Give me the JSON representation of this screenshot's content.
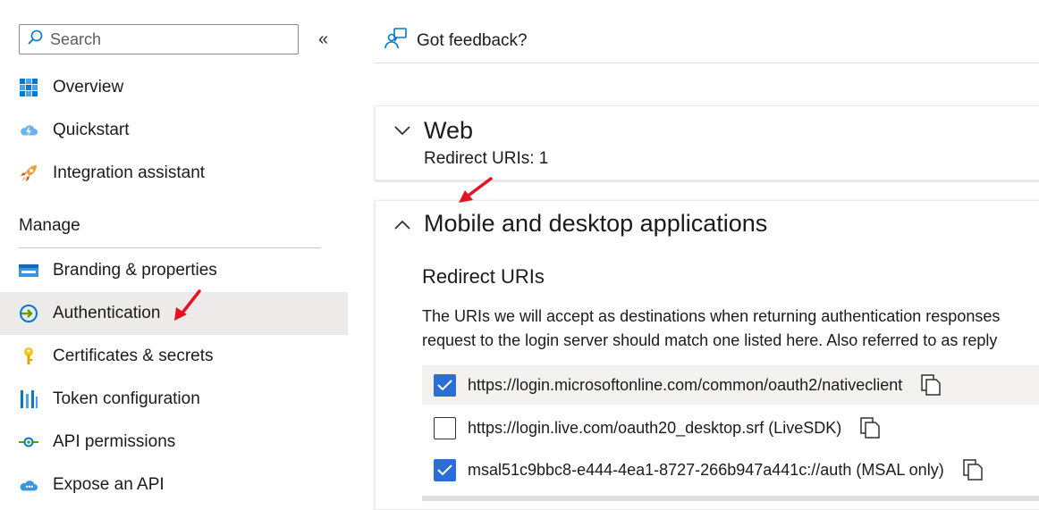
{
  "sidebar": {
    "search_placeholder": "Search",
    "collapse_glyph": "«",
    "items_top": [
      {
        "label": "Overview",
        "icon": "overview-grid-icon"
      },
      {
        "label": "Quickstart",
        "icon": "cloud-bolt-icon"
      },
      {
        "label": "Integration assistant",
        "icon": "rocket-icon"
      }
    ],
    "manage_heading": "Manage",
    "items_manage": [
      {
        "label": "Branding & properties",
        "icon": "branding-icon"
      },
      {
        "label": "Authentication",
        "icon": "authentication-icon",
        "active": true
      },
      {
        "label": "Certificates & secrets",
        "icon": "key-icon"
      },
      {
        "label": "Token configuration",
        "icon": "token-bars-icon"
      },
      {
        "label": "API permissions",
        "icon": "api-permissions-icon"
      },
      {
        "label": "Expose an API",
        "icon": "cloud-api-icon"
      }
    ]
  },
  "topbar": {
    "feedback_label": "Got feedback?"
  },
  "web": {
    "title": "Web",
    "subtitle": "Redirect URIs: 1"
  },
  "mobile": {
    "title": "Mobile and desktop applications",
    "redirect_heading": "Redirect URIs",
    "description_line1": "The URIs we will accept as destinations when returning authentication responses",
    "description_line2": "request to the login server should match one listed here. Also referred to as reply",
    "uris": [
      {
        "uri": "https://login.microsoftonline.com/common/oauth2/nativeclient",
        "checked": true
      },
      {
        "uri": "https://login.live.com/oauth20_desktop.srf (LiveSDK)",
        "checked": false
      },
      {
        "uri": "msal51c9bbc8-e444-4ea1-8727-266b947a441c://auth (MSAL only)",
        "checked": true
      }
    ]
  },
  "colors": {
    "accent": "#2b6fd6",
    "arrow": "#e81123",
    "active_bg": "#edebe9"
  }
}
